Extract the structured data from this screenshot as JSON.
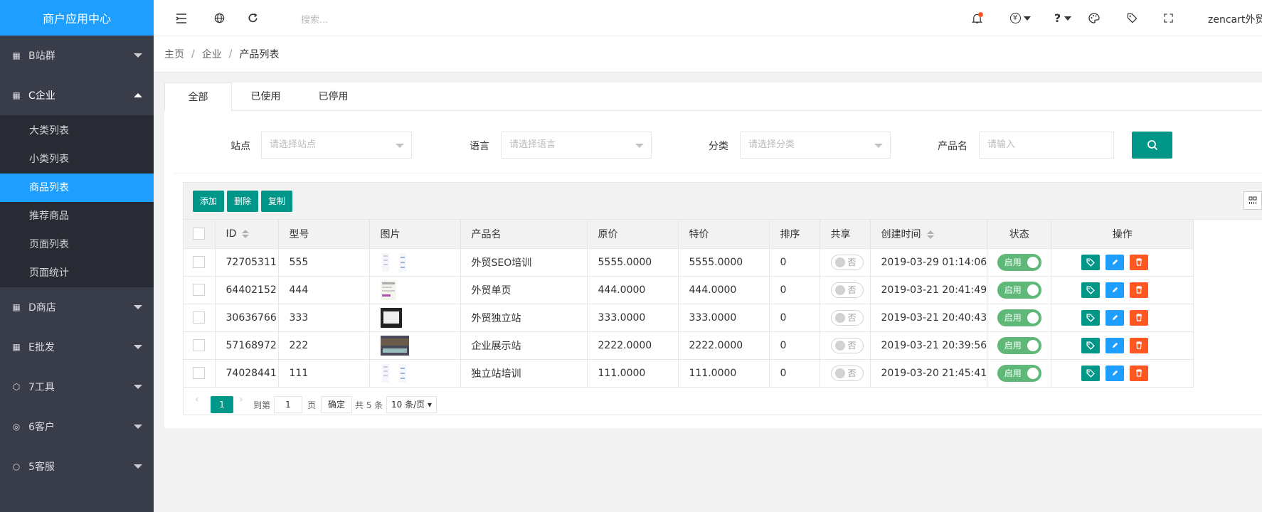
{
  "sidebar": {
    "brand": "商户应用中心",
    "groups": [
      {
        "label": "B站群",
        "icon": "apps-icon"
      },
      {
        "label": "C企业",
        "icon": "apps-icon"
      },
      {
        "label": "D商店",
        "icon": "apps-icon"
      },
      {
        "label": "E批发",
        "icon": "apps-icon"
      },
      {
        "label": "7工具",
        "icon": "cube-icon"
      },
      {
        "label": "6客户",
        "icon": "user-icon"
      },
      {
        "label": "5客服",
        "icon": "chat-icon"
      }
    ],
    "sub_items": [
      "大类列表",
      "小类列表",
      "商品列表",
      "推荐商品",
      "页面列表",
      "页面统计"
    ],
    "active_sub": "商品列表"
  },
  "header": {
    "search_placeholder": "搜索...",
    "currency_symbol": "¥",
    "help_symbol": "?",
    "user": "zencart外贸"
  },
  "breadcrumb": [
    "主页",
    "企业",
    "产品列表"
  ],
  "tabs": [
    "全部",
    "已使用",
    "已停用"
  ],
  "filters": {
    "site_label": "站点",
    "site_placeholder": "请选择站点",
    "lang_label": "语言",
    "lang_placeholder": "请选择语言",
    "cat_label": "分类",
    "cat_placeholder": "请选择分类",
    "name_label": "产品名",
    "name_placeholder": "请输入"
  },
  "toolbar": {
    "add": "添加",
    "delete": "删除",
    "copy": "复制"
  },
  "table": {
    "headers": [
      "ID",
      "型号",
      "图片",
      "产品名",
      "原价",
      "特价",
      "排序",
      "共享",
      "创建时间",
      "状态",
      "操作"
    ],
    "rows": [
      {
        "id": "72705311",
        "model": "555",
        "name": "外贸SEO培训",
        "price": "5555.0000",
        "special": "5555.0000",
        "sort": "0",
        "share": "否",
        "created": "2019-03-29 01:14:06",
        "status": "启用"
      },
      {
        "id": "64402152",
        "model": "444",
        "name": "外贸单页",
        "price": "444.0000",
        "special": "444.0000",
        "sort": "0",
        "share": "否",
        "created": "2019-03-21 20:41:49",
        "status": "启用"
      },
      {
        "id": "30636766",
        "model": "333",
        "name": "外贸独立站",
        "price": "333.0000",
        "special": "333.0000",
        "sort": "0",
        "share": "否",
        "created": "2019-03-21 20:40:43",
        "status": "启用"
      },
      {
        "id": "57168972",
        "model": "222",
        "name": "企业展示站",
        "price": "2222.0000",
        "special": "2222.0000",
        "sort": "0",
        "share": "否",
        "created": "2019-03-21 20:39:56",
        "status": "启用"
      },
      {
        "id": "74028441",
        "model": "111",
        "name": "独立站培训",
        "price": "111.0000",
        "special": "111.0000",
        "sort": "0",
        "share": "否",
        "created": "2019-03-20 21:45:41",
        "status": "启用"
      }
    ]
  },
  "pager": {
    "current": "1",
    "goto_label": "到第",
    "goto_value": "1",
    "page_unit": "页",
    "confirm": "确定",
    "total": "共 5 条",
    "page_size": "10 条/页"
  },
  "colors": {
    "primary": "#009688",
    "accent": "#1e9fff",
    "danger": "#ff5722",
    "sidebar": "#393d49"
  }
}
